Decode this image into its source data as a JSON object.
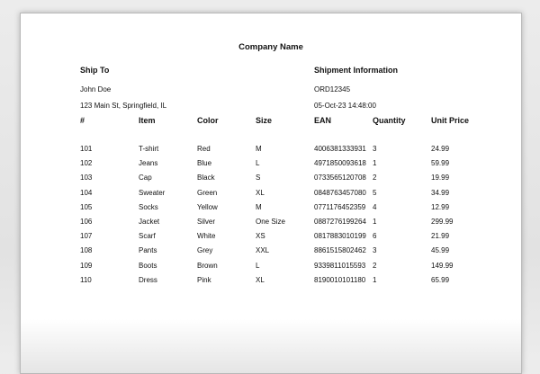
{
  "document": {
    "company_name": "Company Name",
    "ship_to": {
      "label": "Ship To",
      "name": "John Doe",
      "address": "123 Main St, Springfield, IL"
    },
    "shipment_info": {
      "label": "Shipment Information",
      "order_number": "ORD12345",
      "date": "05-Oct-23 14:48:00"
    },
    "table": {
      "headers": [
        "#",
        "Item",
        "Color",
        "Size",
        "EAN",
        "Quantity",
        "Unit Price"
      ],
      "rows": [
        [
          "101",
          "T-shirt",
          "Red",
          "M",
          "4006381333931",
          "3",
          "24.99"
        ],
        [
          "102",
          "Jeans",
          "Blue",
          "L",
          "4971850093618",
          "1",
          "59.99"
        ],
        [
          "103",
          "Cap",
          "Black",
          "S",
          "0733565120708",
          "2",
          "19.99"
        ],
        [
          "104",
          "Sweater",
          "Green",
          "XL",
          "0848763457080",
          "5",
          "34.99"
        ],
        [
          "105",
          "Socks",
          "Yellow",
          "M",
          "0771176452359",
          "4",
          "12.99"
        ],
        [
          "106",
          "Jacket",
          "Silver",
          "One Size",
          "0887276199264",
          "1",
          "299.99"
        ],
        [
          "107",
          "Scarf",
          "White",
          "XS",
          "0817883010199",
          "6",
          "21.99"
        ],
        [
          "108",
          "Pants",
          "Grey",
          "XXL",
          "8861515802462",
          "3",
          "45.99"
        ],
        [
          "109",
          "Boots",
          "Brown",
          "L",
          "9339811015593",
          "2",
          "149.99"
        ],
        [
          "110",
          "Dress",
          "Pink",
          "XL",
          "8190010101180",
          "1",
          "65.99"
        ]
      ]
    }
  }
}
